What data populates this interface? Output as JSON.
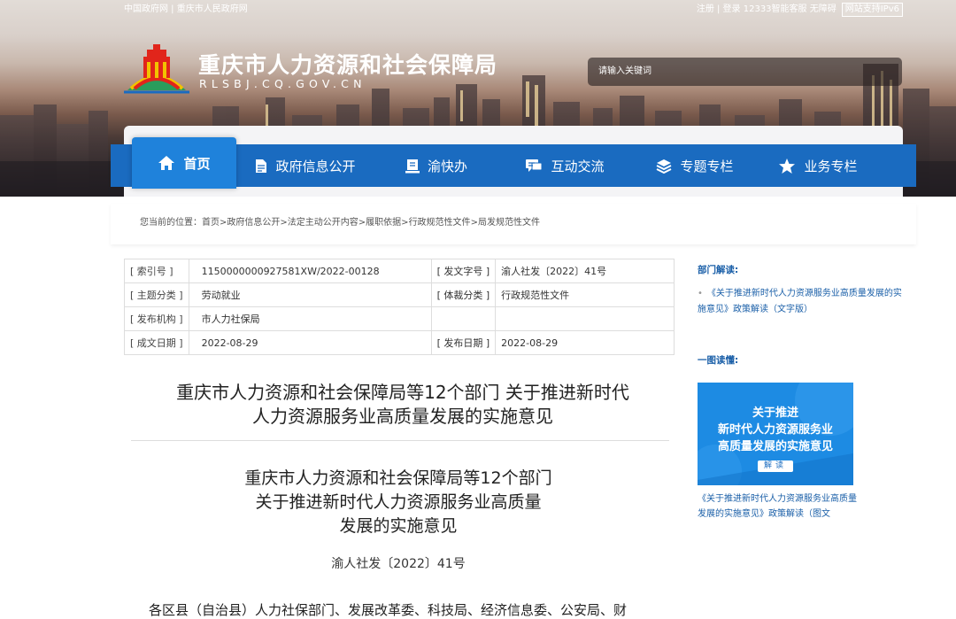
{
  "top_links": {
    "left": "中国政府网 | 重庆市人民政府网",
    "right": "注册 | 登录   12333智能客服   无障碍",
    "ipv6": "网站支持IPv6"
  },
  "header": {
    "title": "重庆市人力资源和社会保障局",
    "domain": "RLSBJ.CQ.GOV.CN",
    "search_placeholder": "请输入关键词"
  },
  "nav": [
    {
      "label": "首页",
      "icon": "home-icon"
    },
    {
      "label": "政府信息公开",
      "icon": "document-icon"
    },
    {
      "label": "渝快办",
      "icon": "service-icon"
    },
    {
      "label": "互动交流",
      "icon": "chat-icon"
    },
    {
      "label": "专题专栏",
      "icon": "layers-icon"
    },
    {
      "label": "业务专栏",
      "icon": "star-icon"
    }
  ],
  "breadcrumb": {
    "prefix": "您当前的位置：",
    "items": [
      "首页",
      "政府信息公开",
      "法定主动公开内容",
      "履职依据",
      "行政规范性文件",
      "局发规范性文件"
    ]
  },
  "meta": {
    "index_label": "[ 索引号 ]",
    "index_value": "11500000009275​81XW/2022-00128",
    "docno_label": "[ 发文字号 ]",
    "docno_value": "渝人社发〔2022〕41号",
    "topic_label": "[ 主题分类 ]",
    "topic_value": "劳动就业",
    "genre_label": "[ 体裁分类 ]",
    "genre_value": "行政规范性文件",
    "org_label": "[ 发布机构 ]",
    "org_value": "市人力社保局",
    "created_label": "[ 成文日期 ]",
    "created_value": "2022-08-29",
    "published_label": "[ 发布日期 ]",
    "published_value": "2022-08-29"
  },
  "article": {
    "title_line1": "重庆市人力资源和社会保障局等12个部门 关于推进新时代",
    "title_line2": "人力资源服务业高质量发展的实施意见",
    "subtitle_line1": "重庆市人力资源和社会保障局等12个部门",
    "subtitle_line2": "关于推进新时代人力资源服务业高质量",
    "subtitle_line3": "发展的实施意见",
    "doc_number": "渝人社发〔2022〕41号",
    "body_start": "各区县（自治县）人力社保部门、发展改革委、科技局、经济信息委、公安局、财"
  },
  "sidebar": {
    "dept_heading": "部门解读:",
    "dept_link": "《关于推进新时代人力资源服务业高质量发展的实施意见》政策解读（文字版）",
    "chart_heading": "一图读懂:",
    "card_line1": "关于推进",
    "card_line2": "新时代人力资源服务业",
    "card_line3": "高质量发展的实施意见",
    "card_button": "解读",
    "card_caption": "《关于推进新时代人力资源服务业高质量发展的实施意见》政策解读（图文"
  }
}
